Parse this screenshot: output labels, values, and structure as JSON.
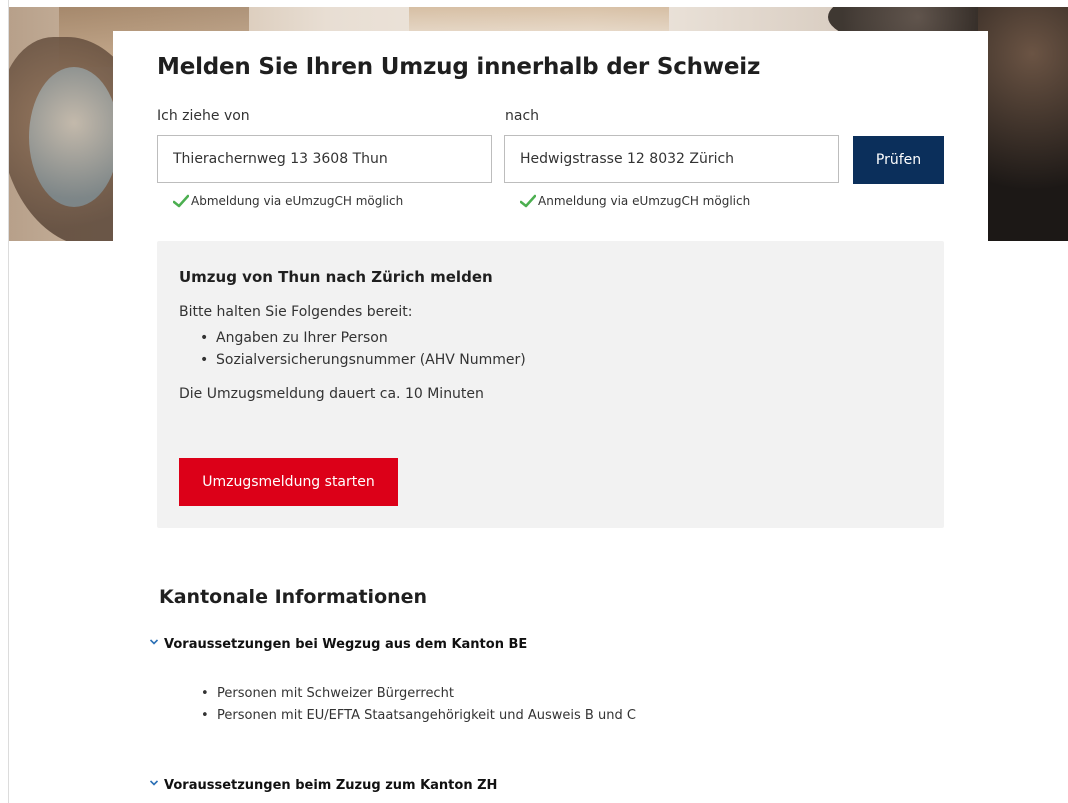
{
  "form": {
    "title": "Melden Sie Ihren Umzug innerhalb der Schweiz",
    "from_label": "Ich ziehe von",
    "from_value": "Thierachernweg 13 3608 Thun",
    "to_label": "nach",
    "to_value": "Hedwigstrasse 12 8032 Zürich",
    "check_button": "Prüfen",
    "from_status": "Abmeldung via eUmzugCH möglich",
    "to_status": "Anmeldung via eUmzugCH möglich"
  },
  "info": {
    "title": "Umzug von Thun nach Zürich melden",
    "intro": "Bitte halten Sie Folgendes bereit:",
    "items": [
      "Angaben zu Ihrer Person",
      "Sozialversicherungsnummer (AHV Nummer)"
    ],
    "duration": "Die Umzugsmeldung dauert ca. 10 Minuten",
    "start_button": "Umzugsmeldung starten"
  },
  "cantonal": {
    "title": "Kantonale Informationen",
    "sections": [
      {
        "title": "Voraussetzungen bei Wegzug aus dem Kanton BE",
        "items": [
          "Personen mit Schweizer Bürgerrecht",
          "Personen mit EU/EFTA Staatsangehörigkeit und Ausweis B und C"
        ]
      },
      {
        "title": "Voraussetzungen beim Zuzug zum Kanton ZH"
      }
    ]
  },
  "colors": {
    "primary_button": "#0b2f5b",
    "start_button": "#dc0018",
    "check_green": "#4caf50",
    "panel_bg": "#f2f2f2"
  },
  "icons": {
    "status": "check-icon",
    "accordion": "chevron-down-icon"
  }
}
